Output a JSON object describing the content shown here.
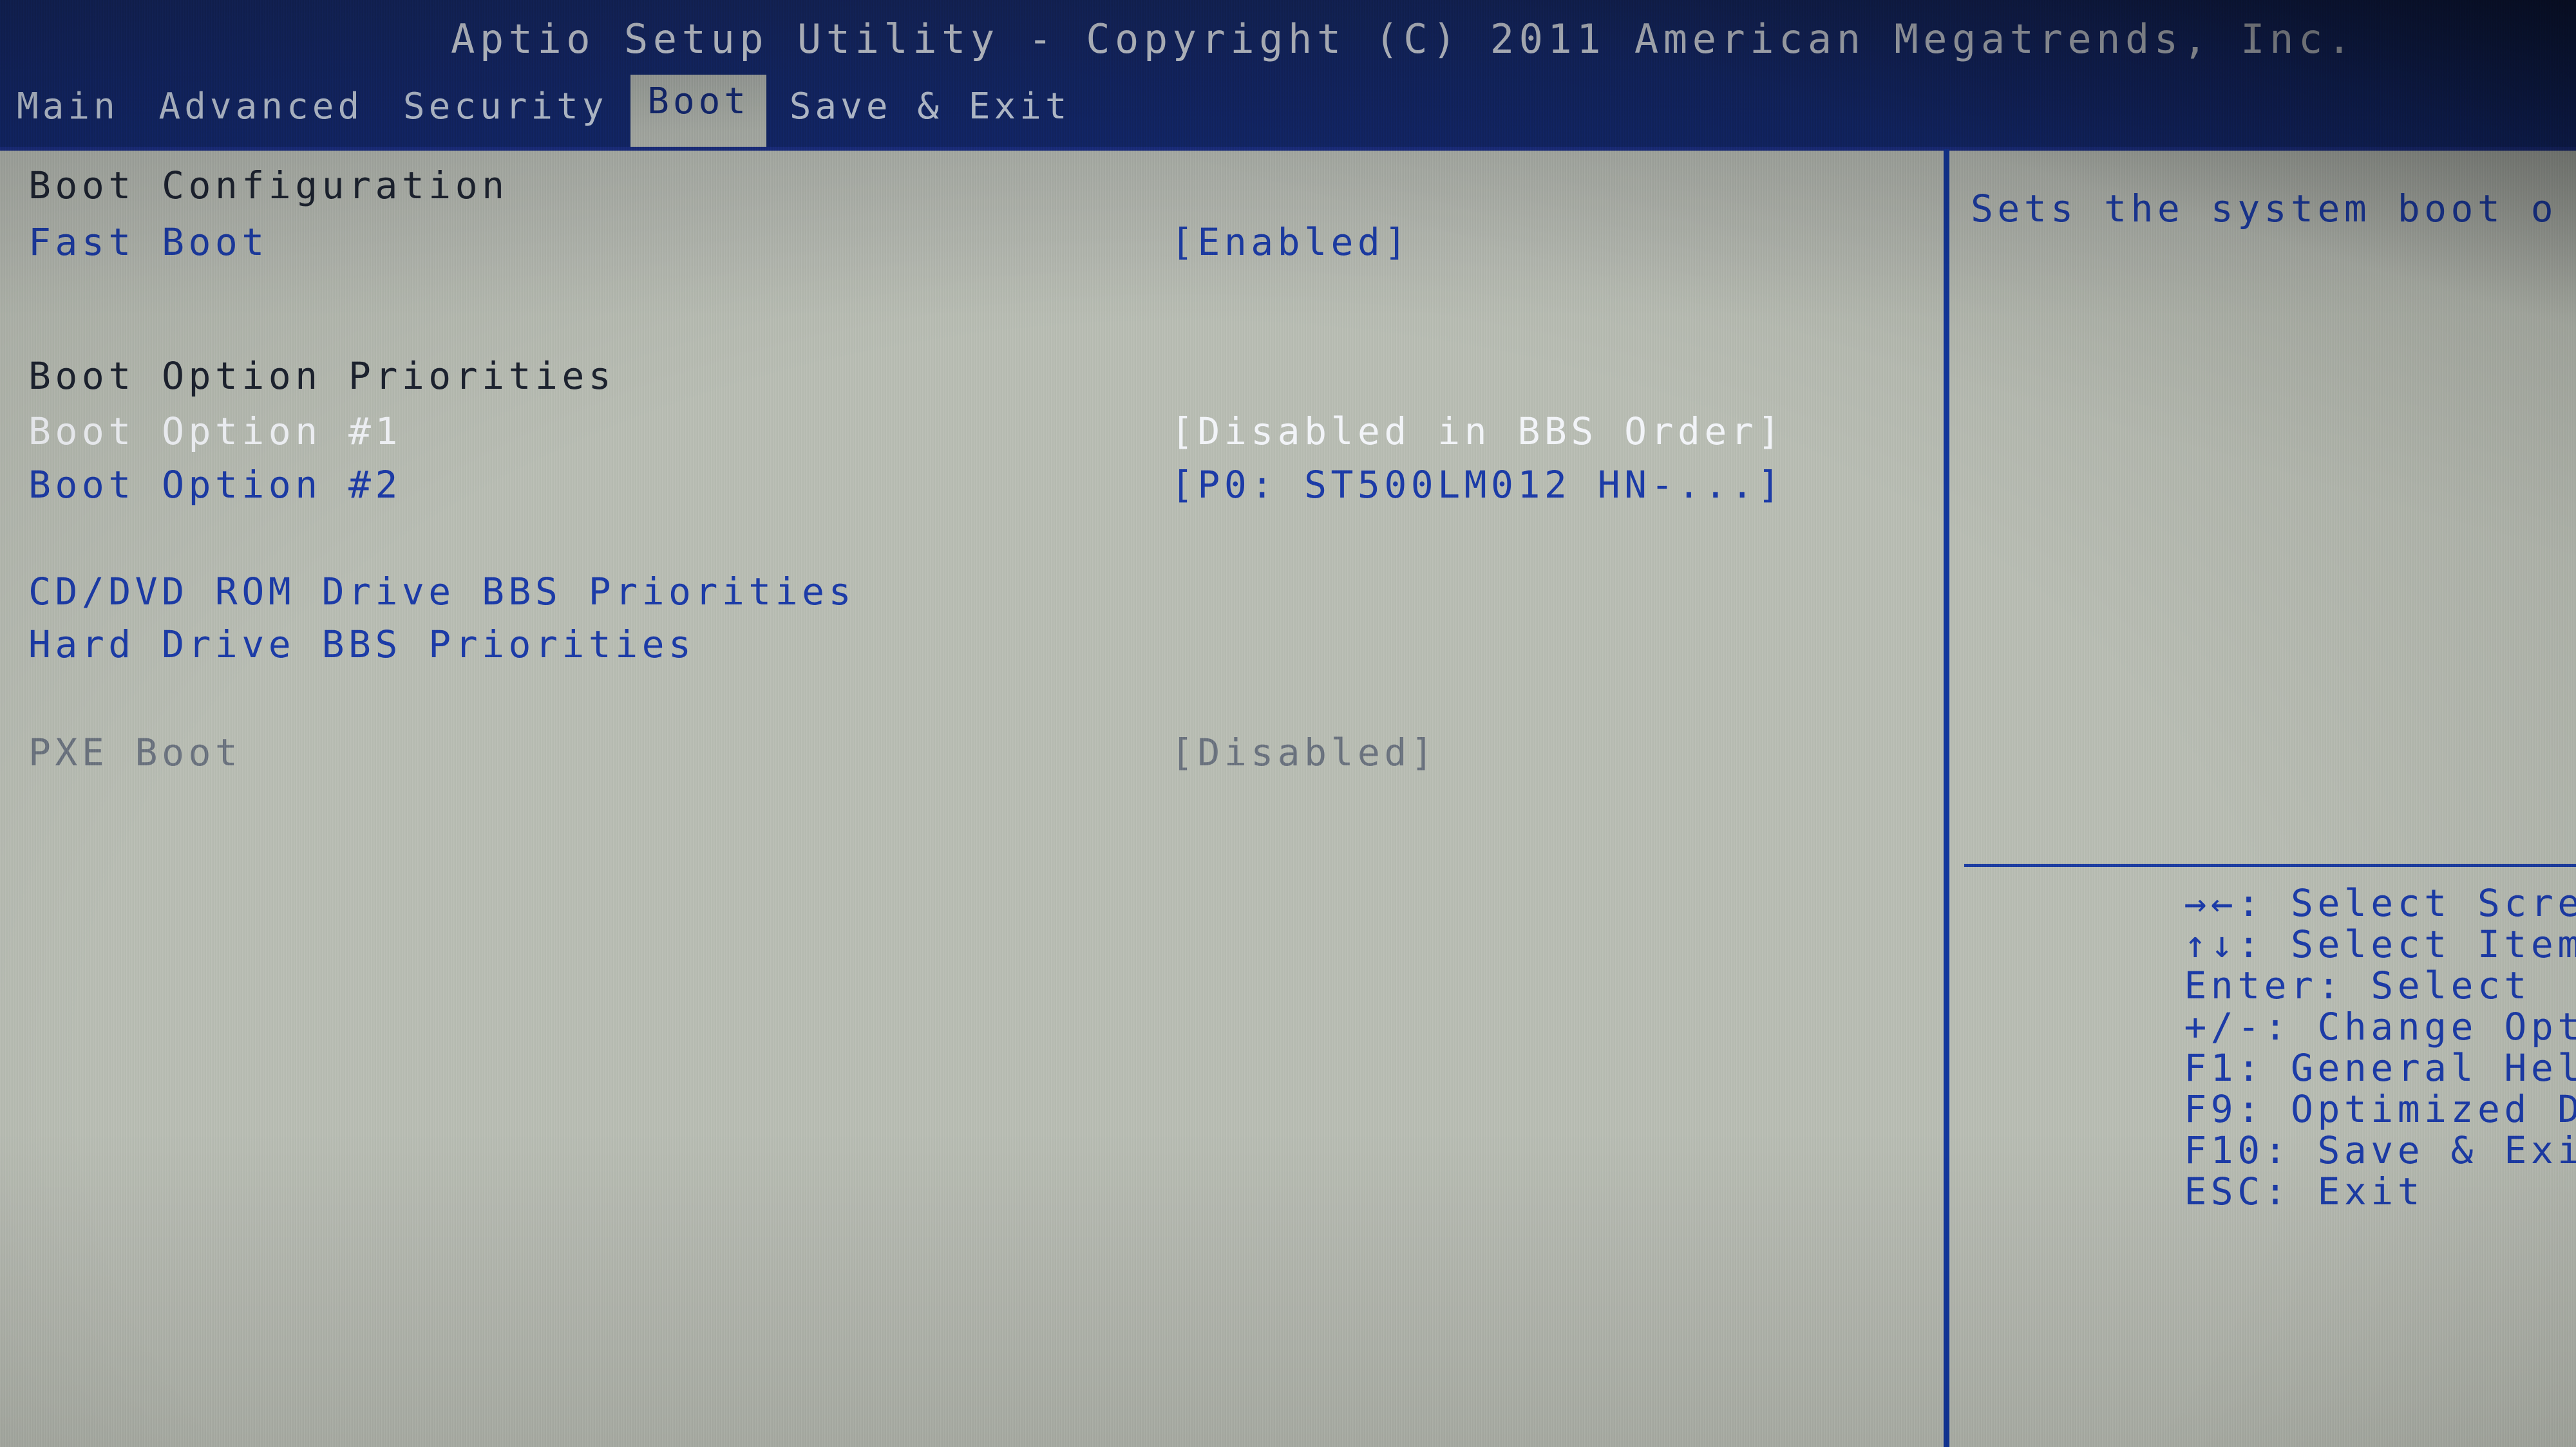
{
  "header": {
    "title": "Aptio Setup Utility - Copyright (C) 2011 American Megatrends, Inc."
  },
  "tabs": [
    {
      "label": "Main",
      "active": false
    },
    {
      "label": "Advanced",
      "active": false
    },
    {
      "label": "Security",
      "active": false
    },
    {
      "label": "Boot",
      "active": true
    },
    {
      "label": "Save & Exit",
      "active": false
    }
  ],
  "settings": [
    {
      "label": "Boot Configuration",
      "value": "",
      "state": "header"
    },
    {
      "label": "Fast Boot",
      "value": "[Enabled]",
      "state": "normal"
    },
    {
      "label": "Boot Option Priorities",
      "value": "",
      "state": "header"
    },
    {
      "label": "Boot Option #1",
      "value": "[Disabled in BBS Order]",
      "state": "selected"
    },
    {
      "label": "Boot Option #2",
      "value": "[P0: ST500LM012 HN-...]",
      "state": "normal"
    },
    {
      "label": "CD/DVD ROM Drive BBS Priorities",
      "value": "",
      "state": "normal"
    },
    {
      "label": "Hard Drive BBS Priorities",
      "value": "",
      "state": "normal"
    },
    {
      "label": "PXE Boot",
      "value": "[Disabled]",
      "state": "disabled"
    }
  ],
  "help": {
    "description": "Sets the system boot o"
  },
  "legend": [
    {
      "key": "→←:",
      "action": " Select Screen"
    },
    {
      "key": "↑↓:",
      "action": " Select Item"
    },
    {
      "key": "Enter:",
      "action": " Select"
    },
    {
      "key": "+/-:",
      "action": " Change Opt."
    },
    {
      "key": "F1:",
      "action": " General Help"
    },
    {
      "key": "F9:",
      "action": " Optimized Defaults"
    },
    {
      "key": "F10:",
      "action": " Save & Exit"
    },
    {
      "key": "ESC:",
      "action": " Exit"
    }
  ],
  "colors": {
    "screen_bg": "#b9bdb4",
    "title_bg": "#12276e",
    "title_fg": "#e9edf5",
    "item_blue": "#1c3ca8",
    "header_dark": "#1d2330",
    "selected_white": "#f2f4f8",
    "disabled_grey": "#6c7480",
    "divider_blue": "#12379f"
  }
}
